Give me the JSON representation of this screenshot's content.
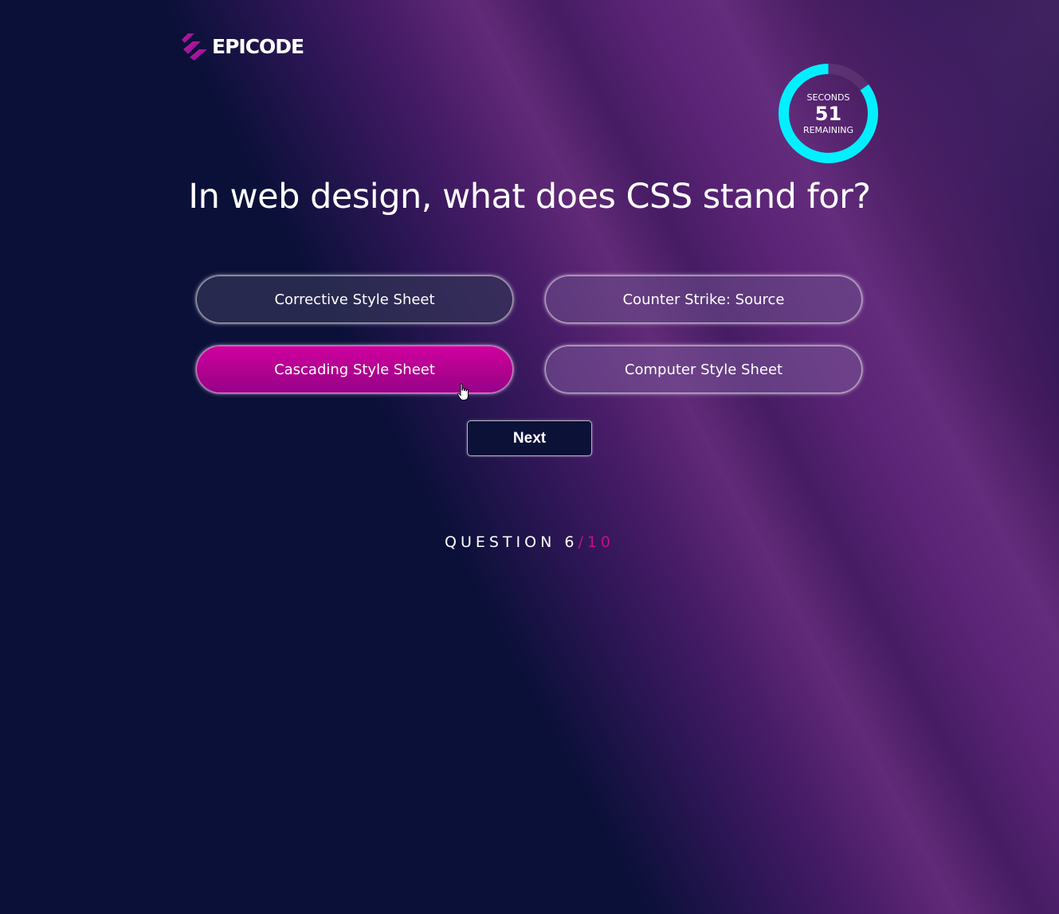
{
  "brand": {
    "name": "EPICODE",
    "accent_color": "#c2128a"
  },
  "timer": {
    "top_label": "SECONDS",
    "value": "51",
    "bottom_label": "REMAINING",
    "ring_color": "#00f0ff",
    "fraction_remaining": 0.85
  },
  "question": {
    "text": "In web design, what does CSS stand for?"
  },
  "answers": [
    {
      "label": "Corrective Style Sheet",
      "selected": false
    },
    {
      "label": "Counter Strike: Source",
      "selected": false
    },
    {
      "label": "Cascading Style Sheet",
      "selected": true
    },
    {
      "label": "Computer Style Sheet",
      "selected": false
    }
  ],
  "next_button": {
    "label": "Next"
  },
  "progress": {
    "prefix": "QUESTION",
    "current": "6",
    "total": "/10"
  },
  "icons": {
    "logo": "epicode-logo-icon",
    "cursor": "hand-pointer-icon"
  }
}
